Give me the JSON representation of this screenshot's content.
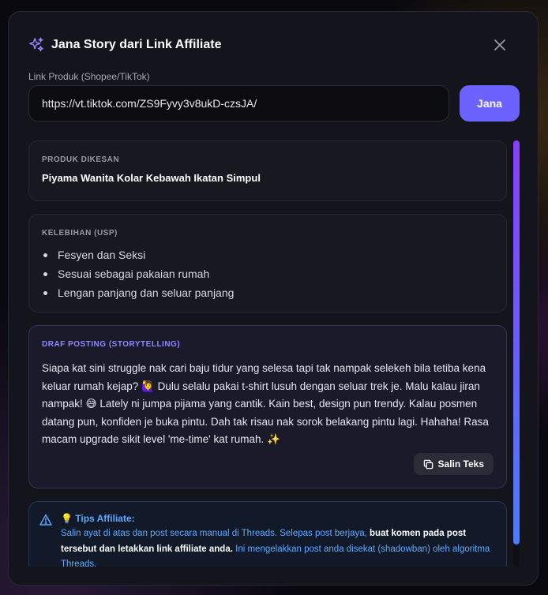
{
  "modal": {
    "title": "Jana Story dari Link Affiliate",
    "close_icon": "close-icon",
    "sparkle_icon": "sparkle-icon"
  },
  "form": {
    "link_label": "Link Produk (Shopee/TikTok)",
    "link_value": "https://vt.tiktok.com/ZS9Fyvy3v8ukD-czsJA/",
    "generate_label": "Jana"
  },
  "product": {
    "label": "PRODUK DIKESAN",
    "name": "Piyama Wanita Kolar Kebawah Ikatan Simpul"
  },
  "usp": {
    "label": "KELEBIHAN (USP)",
    "items": [
      "Fesyen dan Seksi",
      "Sesuai sebagai pakaian rumah",
      "Lengan panjang dan seluar panjang"
    ]
  },
  "draft": {
    "label": "DRAF POSTING (STORYTELLING)",
    "text": "Siapa kat sini struggle nak cari baju tidur yang selesa tapi tak nampak selekeh bila tetiba kena keluar rumah kejap? 🙋‍♀️ Dulu selalu pakai t-shirt lusuh dengan seluar trek je. Malu kalau jiran nampak! 😅 Lately ni jumpa pijama yang cantik. Kain best, design pun trendy. Kalau posmen datang pun, konfiden je buka pintu. Dah tak risau nak sorok belakang pintu lagi. Hahaha! Rasa macam upgrade sikit level 'me-time' kat rumah. ✨",
    "copy_label": "Salin Teks"
  },
  "tips": {
    "title": "💡 Tips Affiliate:",
    "text_1": "Salin ayat di atas dan post secara manual di Threads. Selepas post berjaya, ",
    "text_bold": "buat komen pada post tersebut dan letakkan link affiliate anda.",
    "text_2": " Ini mengelakkan post anda disekat (shadowban) oleh algoritma Threads."
  },
  "colors": {
    "accent": "#6c63ff",
    "tips_blue": "#5fa8ff",
    "draft_label": "#8e88ff"
  }
}
